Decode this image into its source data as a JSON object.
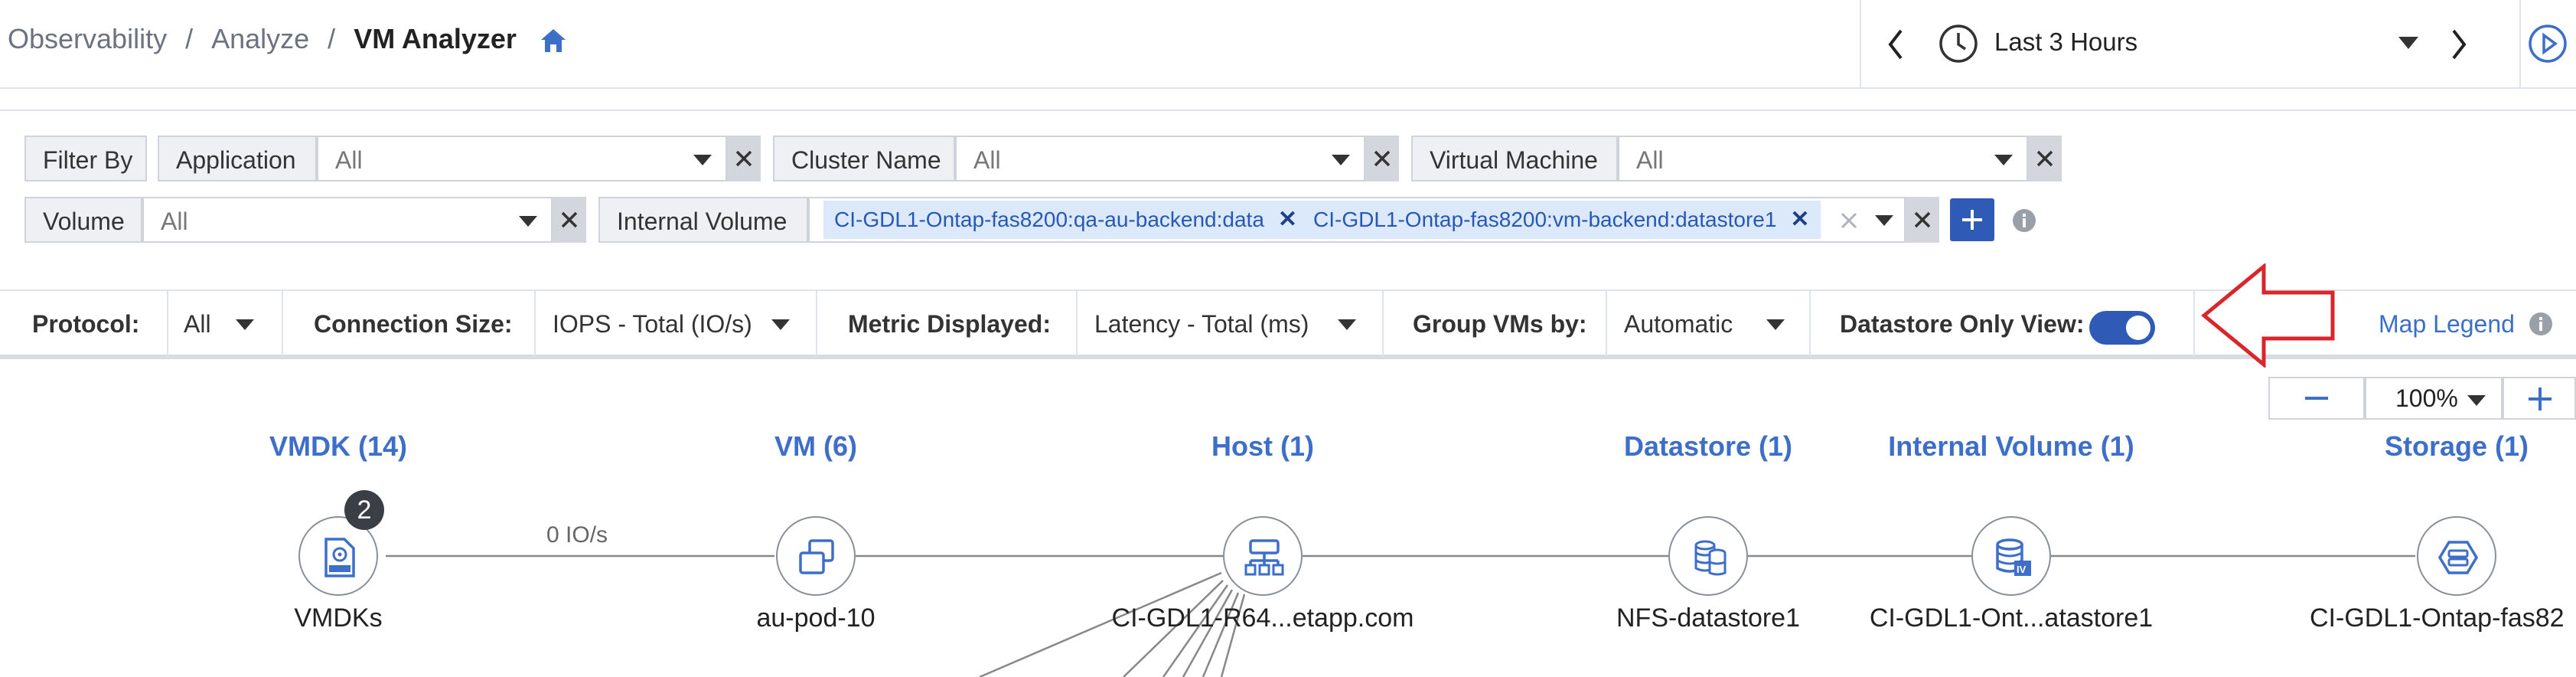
{
  "breadcrumb": {
    "items": [
      "Observability",
      "Analyze"
    ],
    "current": "VM Analyzer"
  },
  "time_range": {
    "label": "Last 3 Hours"
  },
  "filters": {
    "filter_by_label": "Filter By",
    "application": {
      "label": "Application",
      "value": "All"
    },
    "cluster_name": {
      "label": "Cluster Name",
      "value": "All"
    },
    "virtual_machine": {
      "label": "Virtual Machine",
      "value": "All"
    },
    "volume": {
      "label": "Volume",
      "value": "All"
    },
    "internal_volume": {
      "label": "Internal Volume",
      "tags": [
        "CI-GDL1-Ontap-fas8200:qa-au-backend:data",
        "CI-GDL1-Ontap-fas8200:vm-backend:datastore1"
      ]
    }
  },
  "options": {
    "protocol": {
      "label": "Protocol:",
      "value": "All"
    },
    "connection_size": {
      "label": "Connection Size:",
      "value": "IOPS - Total (IO/s)"
    },
    "metric_displayed": {
      "label": "Metric Displayed:",
      "value": "Latency - Total (ms)"
    },
    "group_vms_by": {
      "label": "Group VMs by:",
      "value": "Automatic"
    },
    "datastore_only_view": {
      "label": "Datastore Only View:",
      "on": true
    },
    "map_legend": "Map Legend"
  },
  "zoom": {
    "value": "100%"
  },
  "topology": {
    "columns": [
      {
        "title": "VMDK (14)",
        "node_label": "VMDKs",
        "icon": "vmdk-icon",
        "badge": "2"
      },
      {
        "title": "VM (6)",
        "node_label": "au-pod-10",
        "icon": "vm-icon"
      },
      {
        "title": "Host (1)",
        "node_label": "CI-GDL1-R64...etapp.com",
        "icon": "host-icon"
      },
      {
        "title": "Datastore (1)",
        "node_label": "NFS-datastore1",
        "icon": "datastore-icon"
      },
      {
        "title": "Internal Volume (1)",
        "node_label": "CI-GDL1-Ont...atastore1",
        "icon": "internal-volume-icon"
      },
      {
        "title": "Storage (1)",
        "node_label": "CI-GDL1-Ontap-fas82",
        "icon": "storage-icon"
      }
    ],
    "edge_label": "0 IO/s"
  },
  "colors": {
    "accent": "#3d6ec9",
    "toggle": "#2f5bb7",
    "arrow": "#d9262b",
    "tag_bg": "#dbe9fb"
  }
}
